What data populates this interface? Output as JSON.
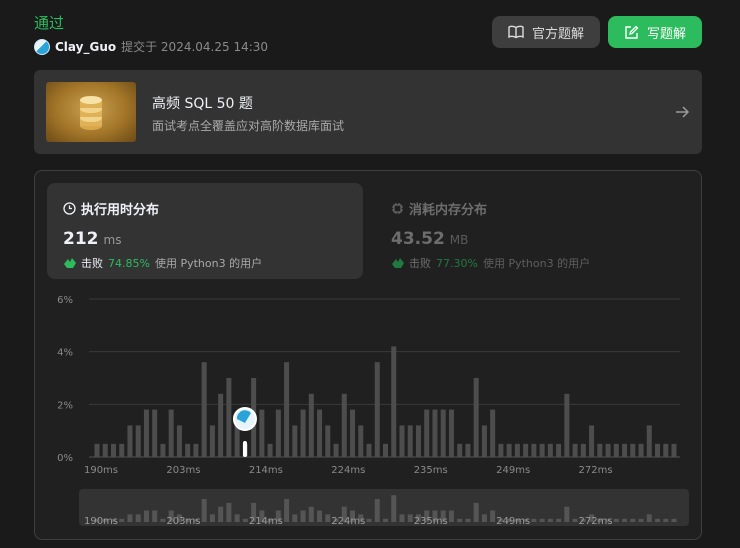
{
  "submission": {
    "status": "通过",
    "username": "Clay_Guo",
    "submitted_at": "提交于 2024.04.25 14:30"
  },
  "buttons": {
    "official_solution": "官方题解",
    "write_solution": "写题解"
  },
  "banner": {
    "title": "高频 SQL 50 题",
    "subtitle": "面试考点全覆盖应对高阶数据库面试"
  },
  "runtime_card": {
    "title": "执行用时分布",
    "value": "212",
    "unit": "ms",
    "beat_label": "击败",
    "beat_pct": "74.85%",
    "beat_suffix": "使用 Python3 的用户"
  },
  "memory_card": {
    "title": "消耗内存分布",
    "value": "43.52",
    "unit": "MB",
    "beat_label": "击败",
    "beat_pct": "77.30%",
    "beat_suffix": "使用 Python3 的用户"
  },
  "colors": {
    "accept_green": "#2cbb5d",
    "bar": "#4d4d4d",
    "bar_mini": "#555555"
  },
  "chart_data": {
    "type": "bar",
    "ylabel": "",
    "xlabel": "",
    "ylim": [
      0,
      6
    ],
    "y_ticks": [
      "0%",
      "2%",
      "4%",
      "6%"
    ],
    "x_tick_labels": [
      "190ms",
      "203ms",
      "214ms",
      "224ms",
      "235ms",
      "249ms",
      "272ms"
    ],
    "x_tick_bar_index": [
      0,
      10,
      20,
      30,
      40,
      50,
      60
    ],
    "values": [
      0.5,
      0.5,
      0.5,
      0.5,
      1.2,
      1.2,
      1.8,
      1.8,
      0.5,
      1.8,
      1.2,
      0.5,
      0.5,
      3.6,
      1.2,
      2.4,
      3.0,
      1.2,
      0.5,
      3.0,
      1.8,
      0.5,
      1.8,
      3.6,
      1.2,
      1.8,
      2.4,
      1.8,
      1.2,
      0.5,
      2.4,
      1.8,
      1.2,
      0.5,
      3.6,
      0.5,
      4.2,
      1.2,
      1.2,
      1.2,
      1.8,
      1.8,
      1.8,
      1.8,
      0.5,
      0.5,
      3.0,
      1.2,
      1.8,
      0.5,
      0.5,
      0.5,
      0.5,
      0.5,
      0.5,
      0.5,
      0.5,
      2.4,
      0.5,
      0.5,
      1.2,
      0.5,
      0.5,
      0.5,
      0.5,
      0.5,
      0.5,
      1.2,
      0.5,
      0.5,
      0.5
    ],
    "marker_bar_index": 19
  }
}
